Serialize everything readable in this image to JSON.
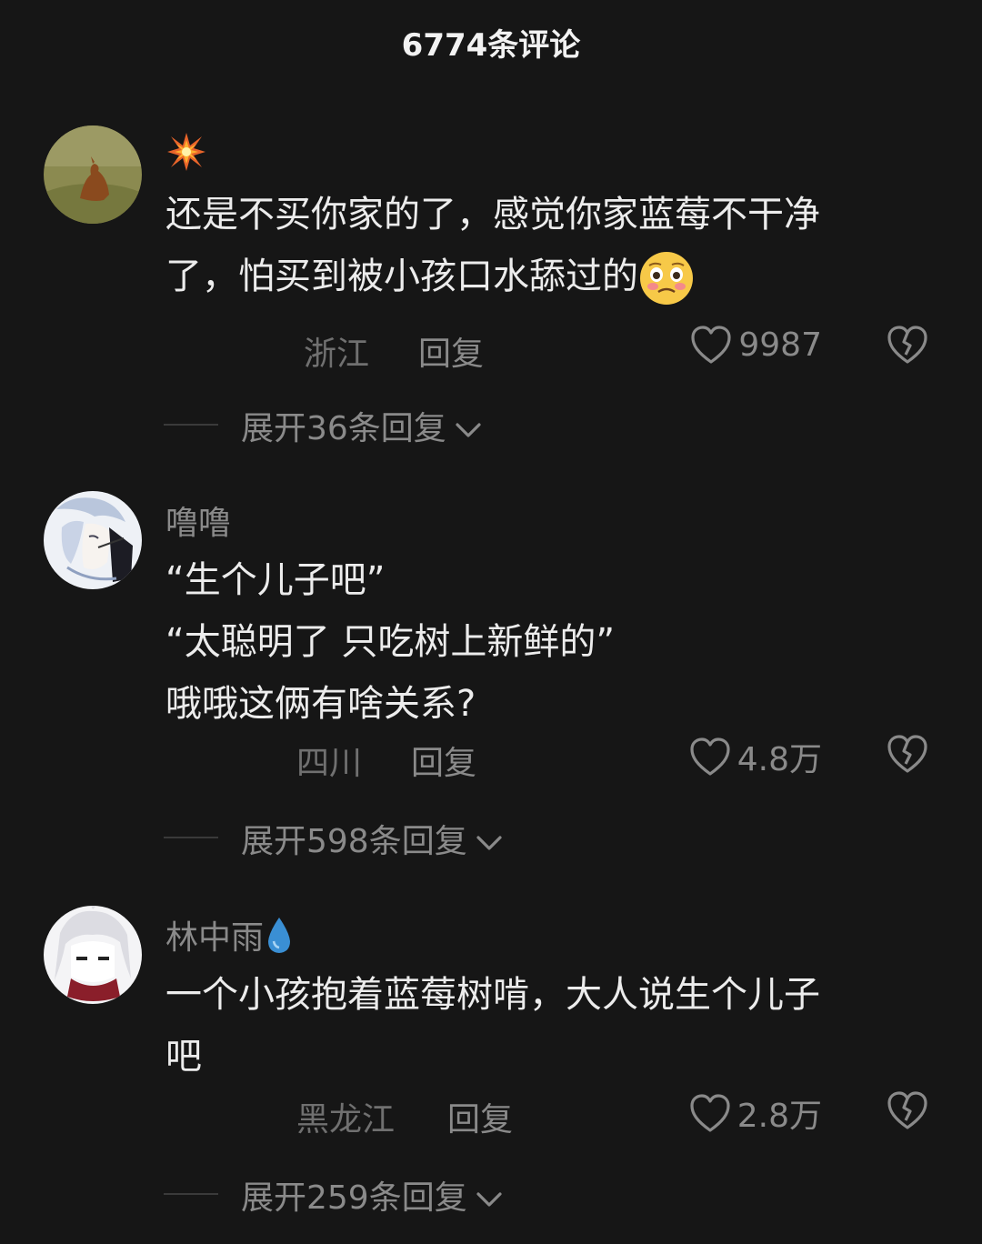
{
  "header": {
    "title": "6774条评论"
  },
  "comments": [
    {
      "username": "",
      "username_icon": "explosion-icon",
      "avatar": "horse-photo-avatar",
      "text": "还是不买你家的了，感觉你家蓝莓不干净\n了，怕买到被小孩口水舔过的",
      "inline_emoji": "pleading-face-emoji",
      "location": "浙江",
      "reply_label": "回复",
      "like_count": "9987",
      "expand_label": "展开36条回复"
    },
    {
      "username": "噜噜",
      "avatar": "anime-character-avatar",
      "text": "“生个儿子吧”\n“太聪明了 只吃树上新鲜的”\n哦哦这俩有啥关系?",
      "location": "四川",
      "reply_label": "回复",
      "like_count": "4.8万",
      "expand_label": "展开598条回复"
    },
    {
      "username": "林中雨",
      "username_icon": "water-drop-icon",
      "avatar": "anime-white-hair-avatar",
      "text": "一个小孩抱着蓝莓树啃，大人说生个儿子\n吧",
      "location": "黑龙江",
      "reply_label": "回复",
      "like_count": "2.8万",
      "expand_label": "展开259条回复"
    }
  ],
  "colors": {
    "background": "#161616",
    "primary_text": "#ececec",
    "secondary_text": "#8a8a8a",
    "muted_text": "#707070"
  }
}
